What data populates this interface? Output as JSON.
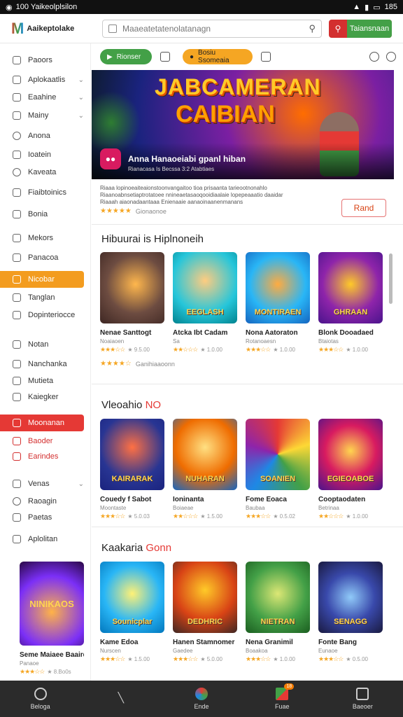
{
  "status_bar": {
    "time": "100 Yaikeolplsilon",
    "battery": "185"
  },
  "header": {
    "logo_mark": "M",
    "logo_text": "Aaikeptolake",
    "search_placeholder": "Maaeatetatenolatanagn",
    "action_button": "Taiansnaan"
  },
  "sidebar": {
    "items": [
      {
        "label": "Paoors",
        "top": 0
      },
      {
        "label": "Aplokaatlis",
        "chevron": true
      },
      {
        "label": "Eaahine",
        "chevron": true
      },
      {
        "label": "Mainy",
        "chevron": true
      },
      {
        "label": "Anona"
      },
      {
        "label": "Ioatein"
      },
      {
        "label": "Kaveata"
      },
      {
        "label": "Fiaibtoinics"
      },
      {
        "label": "Bonia"
      },
      {
        "label": "Mekors"
      },
      {
        "label": "Panacoa"
      },
      {
        "label": "Nicobar"
      },
      {
        "label": "Tanglan"
      },
      {
        "label": "Dopinteriocce"
      },
      {
        "label": "Notan"
      },
      {
        "label": "Nanchanka"
      },
      {
        "label": "Mutieta"
      },
      {
        "label": "Kaiegker"
      },
      {
        "label": "Moonanan"
      },
      {
        "label": "Baoder"
      },
      {
        "label": "Earindes"
      },
      {
        "label": "Venas",
        "chevron": true
      },
      {
        "label": "Raoagin"
      },
      {
        "label": "Paetas"
      },
      {
        "label": "Aplolitan"
      }
    ],
    "featured_card": {
      "image_text": "NINIKAOS",
      "title": "Seme Maiaee Baaird",
      "sub": "Panaoe",
      "stars": "★★★☆☆",
      "count": "★ 8.Bo0s"
    }
  },
  "main": {
    "pills": {
      "green": "Rionser",
      "orange": "Bosiu Ssomeaia"
    },
    "hero": {
      "title_line1": "JABCAMERAN",
      "title_line2": "CAIBIAN",
      "app_title": "Anna Hanaoeiabi gpanl hiban",
      "app_sub": "Rianacasa Is Becssa 3:2 Atabtiaes"
    },
    "description": "Riaaa lopinoeaiteaionstoonvangaitoo tioa prisaanta tarieootnonahlo Riaanoabnsetiaptrotatoee nnineaetasaoqooidiaalaie lopepeaaatio daaidar Riaaah aiaonadaantaaa Enienaaie aanaoinaanenmanans",
    "description_rating": {
      "stars": "★★★★★",
      "count": "Gionaonoe"
    },
    "rand_button": "Rand",
    "sections": [
      {
        "title": "Hibuurai is Hiplnoneih",
        "accent": "",
        "cards": [
          {
            "name": "Nenae Santtogt",
            "sub": "Noaiaoen",
            "stars": "★★★☆☆",
            "count": "★ 9.5.00",
            "image_text": ""
          },
          {
            "name": "Atcka Ibt Cadam",
            "sub": "Sa",
            "stars": "★★☆☆☆",
            "count": "★ 1.0.00",
            "image_text": "EEGLASH"
          },
          {
            "name": "Nona Aatoraton",
            "sub": "Rotanoaesn",
            "stars": "★★★☆☆",
            "count": "★ 1.0.00",
            "image_text": "MONTIRAEN"
          },
          {
            "name": "Blonk Dooadaed",
            "sub": "Btaiotas",
            "stars": "★★★☆☆",
            "count": "★ 1.0.00",
            "image_text": "GHRAAN"
          }
        ],
        "extra_rating": {
          "stars": "★★★★☆",
          "count": "Ganihiaaoonn"
        }
      },
      {
        "title": "Vleoahio",
        "accent": "NO",
        "cards": [
          {
            "name": "Couedy f Sabot",
            "sub": "Moontaste",
            "stars": "★★★☆☆",
            "count": "★ 5.0.03",
            "image_text": "KAIRARAK"
          },
          {
            "name": "Ioninanta",
            "sub": "Boiaeae",
            "stars": "★★☆☆☆",
            "count": "★ 1.5.00",
            "image_text": "NUHARAN"
          },
          {
            "name": "Fome Eoaca",
            "sub": "Baubaa",
            "stars": "★★★☆☆",
            "count": "★ 0.5.02",
            "image_text": "SOANIEN"
          },
          {
            "name": "Cooptaodaten",
            "sub": "Betrinaa",
            "stars": "★★☆☆☆",
            "count": "★ 1.0.00",
            "image_text": "EGIEOABOE"
          }
        ]
      },
      {
        "title": "Kaakaria",
        "accent": "Gonn",
        "cards": [
          {
            "name": "Kame Edoa",
            "sub": "Nurscen",
            "stars": "★★★☆☆",
            "count": "★ 1.5.00",
            "image_text": "Sounicplar"
          },
          {
            "name": "Hanen Stamnomer",
            "sub": "Gaedee",
            "stars": "★★★☆☆",
            "count": "★ 5.0.00",
            "image_text": "DEDHRIC"
          },
          {
            "name": "Nena Granimil",
            "sub": "Boaakoa",
            "stars": "★★★☆☆",
            "count": "★ 1.0.00",
            "image_text": "NIETRAN"
          },
          {
            "name": "Fonte Bang",
            "sub": "Eunaoe",
            "stars": "★★★☆☆",
            "count": "★ 0.5.00",
            "image_text": "SENAGG"
          }
        ]
      }
    ]
  },
  "bottom_nav": [
    {
      "label": "Beloga",
      "icon": "home-icon"
    },
    {
      "label": "",
      "icon": "slash-icon"
    },
    {
      "label": "Ende",
      "icon": "apps-icon"
    },
    {
      "label": "Fuae",
      "icon": "flag-icon",
      "badge": "18"
    },
    {
      "label": "Baeoer",
      "icon": "profile-icon"
    }
  ],
  "colors": {
    "accent_red": "#e53935",
    "accent_green": "#43a047",
    "accent_orange": "#f39c1f",
    "star": "#f5a623"
  }
}
